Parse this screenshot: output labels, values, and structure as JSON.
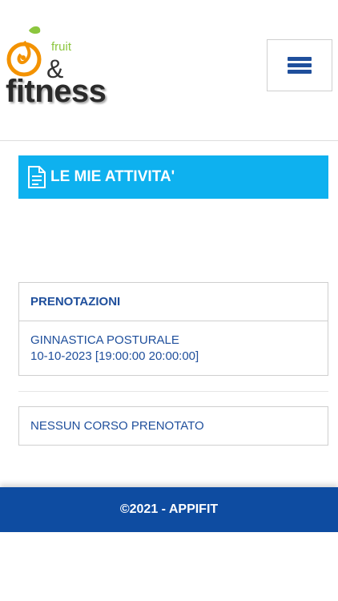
{
  "header": {
    "logo_fruit": "fruit",
    "logo_amp": "&",
    "logo_fitness": "fitness",
    "menu_icon": "hamburger-menu-icon"
  },
  "page_title": {
    "icon": "document-icon",
    "label": "LE MIE ATTIVITA'"
  },
  "bookings": {
    "heading": "PRENOTAZIONI",
    "items": [
      {
        "name": "GINNASTICA POSTURALE",
        "schedule": "10-10-2023 [19:00:00 20:00:00]"
      }
    ]
  },
  "courses": {
    "empty_message": "NESSUN CORSO PRENOTATO"
  },
  "footer": {
    "copyright": "©2021 - APPIFIT"
  },
  "colors": {
    "accent_cyan": "#0eb1ef",
    "primary_blue": "#1f4f9c",
    "footer_blue": "#0e4ca1",
    "logo_orange": "#f39200",
    "logo_green": "#8cc63e"
  }
}
